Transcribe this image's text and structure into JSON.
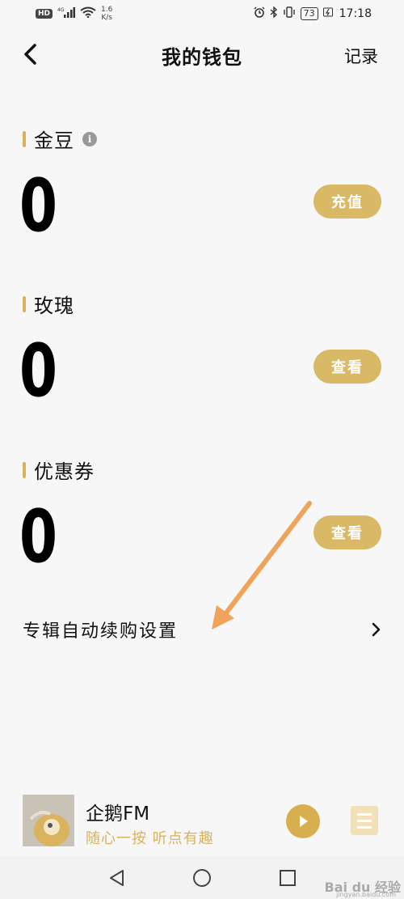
{
  "status_bar": {
    "hd": "HD",
    "signal": "4G",
    "net_speed_value": "1.6",
    "net_speed_unit": "K/s",
    "battery": "73",
    "time": "17:18"
  },
  "header": {
    "title": "我的钱包",
    "record_label": "记录"
  },
  "sections": [
    {
      "label": "金豆",
      "value": "0",
      "button_label": "充值",
      "has_info": true
    },
    {
      "label": "玫瑰",
      "value": "0",
      "button_label": "查看"
    },
    {
      "label": "优惠券",
      "value": "0",
      "button_label": "查看"
    }
  ],
  "settings": {
    "auto_renew_label": "专辑自动续购设置"
  },
  "mini_player": {
    "title": "企鹅FM",
    "subtitle": "随心一按 听点有趣"
  },
  "watermark": {
    "text": "Bai du 经验",
    "sub": "jingyan.baidu.com"
  },
  "colors": {
    "accent": "#d8b35f",
    "button": "#d9b866",
    "arrow": "#f0a35a"
  }
}
